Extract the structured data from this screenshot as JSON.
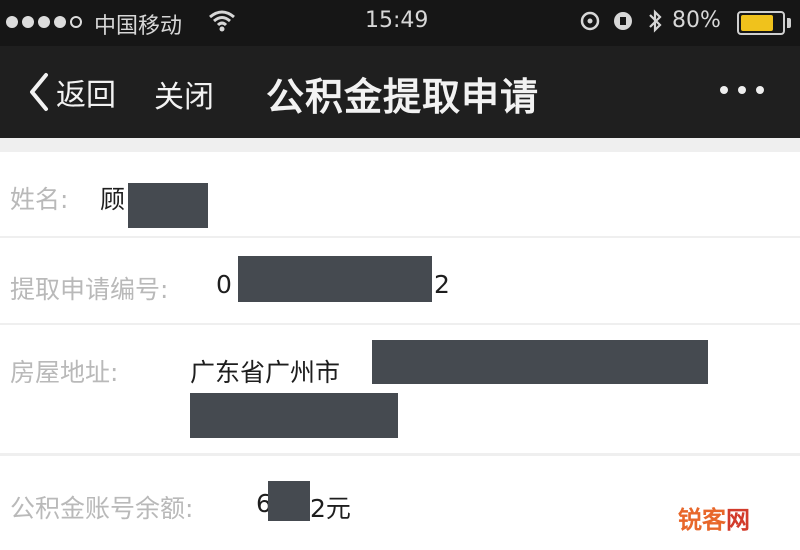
{
  "status_bar": {
    "carrier": "中国移动",
    "time": "15:49",
    "battery_percent": "80%",
    "battery_level": 0.8,
    "battery_color": "#f0c21c"
  },
  "nav": {
    "back_label": "返回",
    "close_label": "关闭",
    "title": "公积金提取申请"
  },
  "fields": [
    {
      "label": "姓名:",
      "value_prefix": "顾",
      "value_suffix": ""
    },
    {
      "label": "提取申请编号:",
      "value_prefix": "0",
      "value_suffix": "2"
    },
    {
      "label": "房屋地址:",
      "value_prefix": "广东省广州市",
      "value_suffix": ""
    },
    {
      "label": "公积金账号余额:",
      "value_prefix": "6",
      "value_suffix": "2元"
    }
  ],
  "watermark": {
    "part1": "锐客",
    "part2": "网"
  }
}
